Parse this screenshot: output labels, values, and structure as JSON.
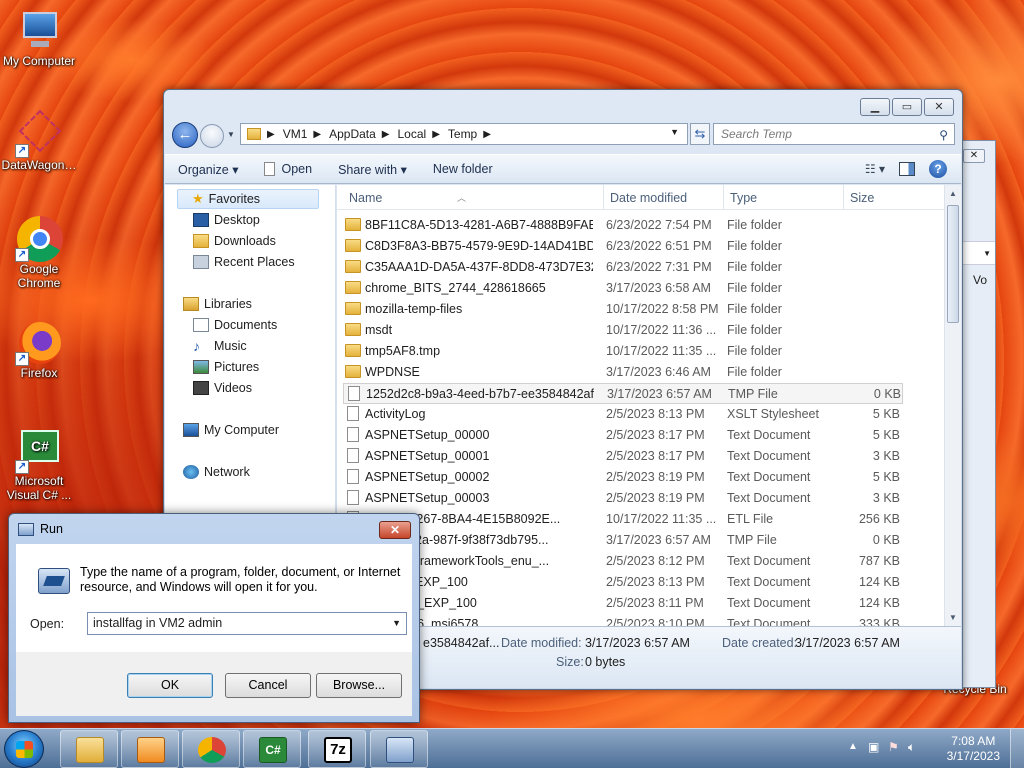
{
  "desktop": {
    "icons": [
      {
        "label": "My Computer",
        "icon": "computer-icon"
      },
      {
        "label": "DataWagon…",
        "icon": "datawagon-icon"
      },
      {
        "label": "Google Chrome",
        "icon": "chrome-icon"
      },
      {
        "label": "Firefox",
        "icon": "firefox-icon"
      },
      {
        "label": "Microsoft Visual C# ...",
        "icon": "visual-csharp-icon"
      },
      {
        "label": "Recycle Bin",
        "icon": "recycle-bin-icon"
      }
    ]
  },
  "explorer": {
    "breadcrumb": [
      "VM1",
      "AppData",
      "Local",
      "Temp"
    ],
    "search_placeholder": "Search Temp",
    "toolbar": {
      "organize": "Organize ▾",
      "open": "Open",
      "share_with": "Share with ▾",
      "new_folder": "New folder"
    },
    "nav": {
      "favorites": "Favorites",
      "desktop": "Desktop",
      "downloads": "Downloads",
      "recent_places": "Recent Places",
      "libraries": "Libraries",
      "documents": "Documents",
      "music": "Music",
      "pictures": "Pictures",
      "videos": "Videos",
      "my_computer": "My Computer",
      "network": "Network"
    },
    "columns": {
      "name": "Name",
      "date": "Date modified",
      "type": "Type",
      "size": "Size"
    },
    "files": [
      {
        "name": "8BF11C8A-5D13-4281-A6B7-4888B9FAB8...",
        "date": "6/23/2022 7:54 PM",
        "type": "File folder",
        "size": "",
        "kind": "folder"
      },
      {
        "name": "C8D3F8A3-BB75-4579-9E9D-14AD41BD3...",
        "date": "6/23/2022 6:51 PM",
        "type": "File folder",
        "size": "",
        "kind": "folder"
      },
      {
        "name": "C35AAA1D-DA5A-437F-8DD8-473D7E327...",
        "date": "6/23/2022 7:31 PM",
        "type": "File folder",
        "size": "",
        "kind": "folder"
      },
      {
        "name": "chrome_BITS_2744_428618665",
        "date": "3/17/2023 6:58 AM",
        "type": "File folder",
        "size": "",
        "kind": "folder"
      },
      {
        "name": "mozilla-temp-files",
        "date": "10/17/2022 8:58 PM",
        "type": "File folder",
        "size": "",
        "kind": "folder"
      },
      {
        "name": "msdt",
        "date": "10/17/2022 11:36 ...",
        "type": "File folder",
        "size": "",
        "kind": "folder"
      },
      {
        "name": "tmp5AF8.tmp",
        "date": "10/17/2022 11:35 ...",
        "type": "File folder",
        "size": "",
        "kind": "folder"
      },
      {
        "name": "WPDNSE",
        "date": "3/17/2023 6:46 AM",
        "type": "File folder",
        "size": "",
        "kind": "folder"
      },
      {
        "name": "1252d2c8-b9a3-4eed-b7b7-ee3584842afb...",
        "date": "3/17/2023 6:57 AM",
        "type": "TMP File",
        "size": "0 KB",
        "kind": "doc"
      },
      {
        "name": "ActivityLog",
        "date": "2/5/2023 8:13 PM",
        "type": "XSLT Stylesheet",
        "size": "5 KB",
        "kind": "doc"
      },
      {
        "name": "ASPNETSetup_00000",
        "date": "2/5/2023 8:17 PM",
        "type": "Text Document",
        "size": "5 KB",
        "kind": "doc"
      },
      {
        "name": "ASPNETSetup_00001",
        "date": "2/5/2023 8:17 PM",
        "type": "Text Document",
        "size": "3 KB",
        "kind": "doc"
      },
      {
        "name": "ASPNETSetup_00002",
        "date": "2/5/2023 8:19 PM",
        "type": "Text Document",
        "size": "5 KB",
        "kind": "doc"
      },
      {
        "name": "ASPNETSetup_00003",
        "date": "2/5/2023 8:19 PM",
        "type": "Text Document",
        "size": "3 KB",
        "kind": "doc"
      },
      {
        "name": "3-8B57-4267-8BA4-4E15B8092E...",
        "date": "10/17/2022 11:35 ...",
        "type": "ETL File",
        "size": "256 KB",
        "kind": "doc"
      },
      {
        "name": "-1730-4d2a-987f-9f38f73db795...",
        "date": "3/17/2023 6:57 AM",
        "type": "TMP File",
        "size": "0 KB",
        "kind": "doc"
      },
      {
        "name": "ETEntityFrameworkTools_enu_...",
        "date": "2/5/2023 8:12 PM",
        "type": "Text Document",
        "size": "787 KB",
        "kind": "doc"
      },
      {
        "name": "eck_VB_EXP_100",
        "date": "2/5/2023 8:13 PM",
        "type": "Text Document",
        "size": "124 KB",
        "kind": "doc"
      },
      {
        "name": "eck_VCS_EXP_100",
        "date": "2/5/2023 8:11 PM",
        "type": "Text Document",
        "size": "124 KB",
        "kind": "doc"
      },
      {
        "name": "hared_x86_msi6578",
        "date": "2/5/2023 8:10 PM",
        "type": "Text Document",
        "size": "333 KB",
        "kind": "doc"
      }
    ],
    "details": {
      "name": "e3584842af...",
      "date_modified_label": "Date modified:",
      "date_modified": "3/17/2023 6:57 AM",
      "date_created_label": "Date created:",
      "date_created": "3/17/2023 6:57 AM",
      "size_label": "Size:",
      "size": "0 bytes"
    }
  },
  "back_window": {
    "label": "Vo"
  },
  "run": {
    "title": "Run",
    "message": "Type the name of a program, folder, document, or Internet resource, and Windows will open it for you.",
    "open_label": "Open:",
    "open_value": "installfag in VM2 admin",
    "ok": "OK",
    "cancel": "Cancel",
    "browse": "Browse..."
  },
  "taskbar": {
    "apps": [
      "explorer-icon",
      "media-player-icon",
      "chrome-icon",
      "visual-csharp-icon",
      "7zip-icon",
      "run-icon"
    ],
    "sevenzip_label": "7z",
    "time": "7:08 AM",
    "date": "3/17/2023"
  }
}
